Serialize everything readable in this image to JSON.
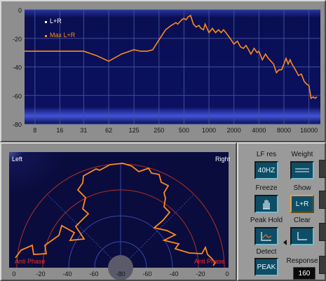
{
  "spectrum": {
    "legend": [
      {
        "label": "L+R",
        "color": "#ffffff"
      },
      {
        "label": "Max L+R",
        "color": "#ff8a1c"
      }
    ],
    "y_ticks": [
      "0",
      "-20",
      "-40",
      "-60",
      "-80"
    ],
    "x_ticks": [
      "8",
      "16",
      "31",
      "62",
      "125",
      "250",
      "500",
      "1000",
      "2000",
      "4000",
      "8000",
      "16000"
    ],
    "curve_color": "#ff8a1c",
    "max_curve": {
      "x": [
        4,
        5.5,
        8,
        12,
        16,
        22,
        31,
        44,
        62,
        88,
        125,
        150,
        180,
        210,
        250,
        300,
        350,
        400,
        420,
        470,
        500,
        530,
        560,
        600,
        650,
        700,
        760,
        800,
        860,
        900,
        1000,
        1100,
        1200,
        1300,
        1400,
        1500,
        1600,
        1800,
        2000,
        2200,
        2400,
        2600,
        2800,
        3000,
        3200,
        3500,
        3800,
        4000,
        4400,
        4800,
        5200,
        5600,
        6000,
        6500,
        7000,
        7500,
        8000,
        8500,
        9000,
        9500,
        10000,
        11000,
        12000,
        13000,
        14000,
        15000,
        16000,
        17000,
        18000,
        19000,
        20000
      ],
      "y": [
        -29,
        -29,
        -29,
        -29,
        -29,
        -29,
        -29,
        -32,
        -36,
        -31,
        -28,
        -29,
        -29,
        -28,
        -21,
        -14,
        -11,
        -9,
        -10,
        -7,
        -6,
        -7,
        -5,
        -4,
        -10,
        -12,
        -11,
        -13,
        -14,
        -10,
        -16,
        -13,
        -16,
        -14,
        -16,
        -14,
        -16,
        -20,
        -24,
        -22,
        -26,
        -27,
        -25,
        -28,
        -31,
        -27,
        -30,
        -29,
        -35,
        -31,
        -34,
        -36,
        -38,
        -44,
        -42,
        -42,
        -38,
        -34,
        -38,
        -35,
        -38,
        -42,
        -46,
        -45,
        -50,
        -52,
        -53,
        -62,
        -61,
        -62,
        -61
      ]
    }
  },
  "phase": {
    "label_left": "Left",
    "label_right": "Right",
    "anti_phase_left": "Anti Phase",
    "anti_phase_right": "Anti Phase",
    "bottom_ticks": [
      "0",
      "-20",
      "-40",
      "-60",
      "-80",
      "-60",
      "-40",
      "-20",
      "0"
    ],
    "curve_color": "#ff8a1c"
  },
  "controls": {
    "lf_res_label": "LF res",
    "lf_res_value": "40HZ",
    "weight_label": "Weight",
    "freeze_label": "Freeze",
    "show_label": "Show",
    "show_value": "L+R",
    "peak_hold_label": "Peak Hold",
    "clear_label": "Clear",
    "detect_label": "Detect",
    "detect_value": "PEAK",
    "response_label": "Response",
    "response_value": "160"
  }
}
